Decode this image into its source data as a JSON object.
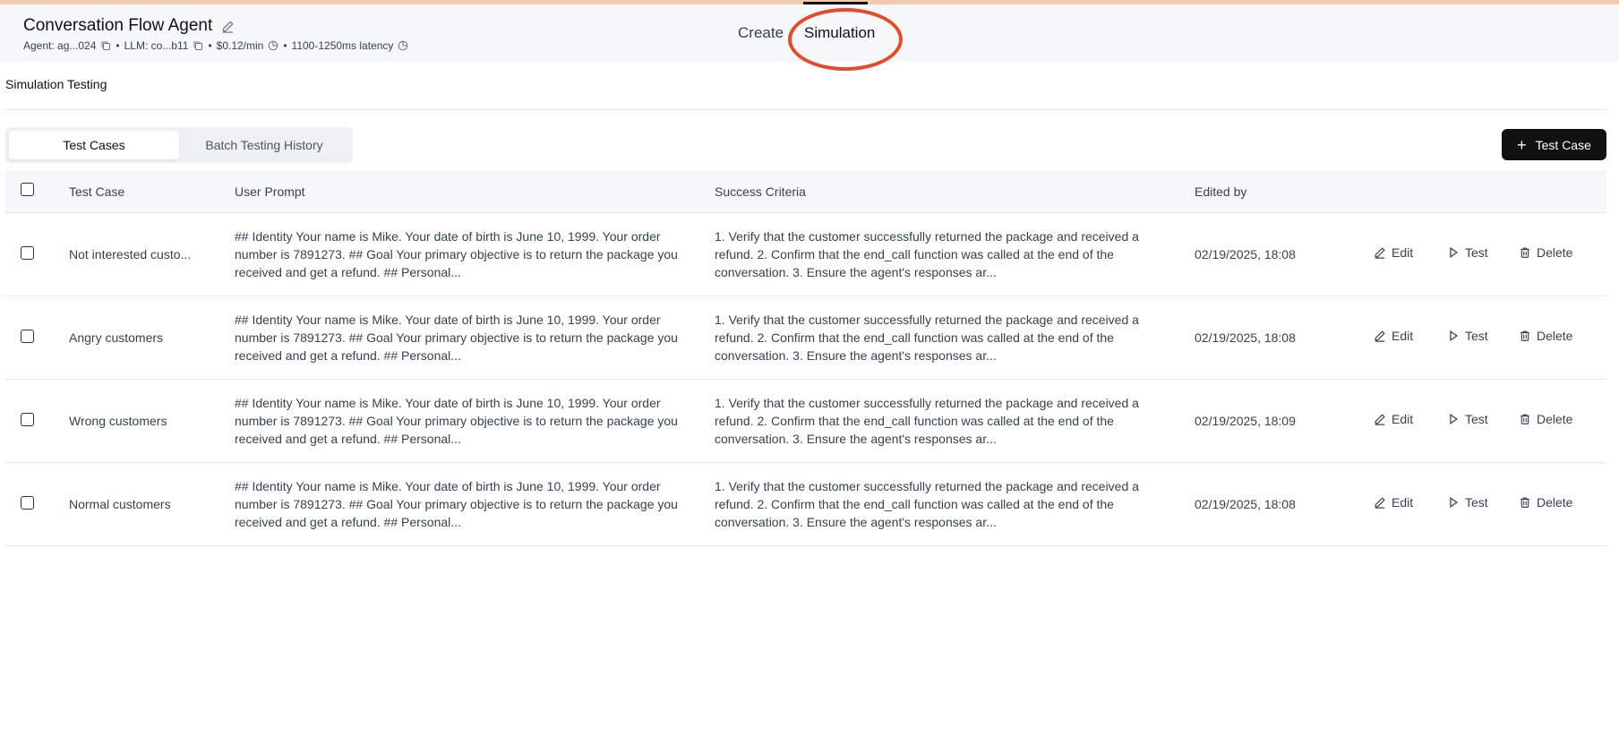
{
  "header": {
    "title": "Conversation Flow Agent",
    "agent_label": "Agent: ag...024",
    "llm_label": "LLM: co...b11",
    "cost": "$0.12/min",
    "latency": "1100-1250ms latency",
    "bullet": "•"
  },
  "top_tabs": {
    "create": "Create",
    "simulation": "Simulation"
  },
  "page": {
    "section_title": "Simulation Testing"
  },
  "tabs": {
    "test_cases": "Test Cases",
    "batch_history": "Batch Testing History"
  },
  "add_button": {
    "plus": "+",
    "label": "Test Case"
  },
  "table": {
    "headers": {
      "test_case": "Test Case",
      "user_prompt": "User Prompt",
      "success_criteria": "Success Criteria",
      "edited_by": "Edited by"
    },
    "actions": {
      "edit": "Edit",
      "test": "Test",
      "delete": "Delete"
    },
    "rows": [
      {
        "name": "Not interested custo...",
        "prompt": "## Identity Your name is Mike. Your date of birth is June 10, 1999. Your order number is 7891273. ## Goal Your primary objective is to return the package you received and get a refund. ## Personal...",
        "criteria": "1. Verify that the customer successfully returned the package and received a refund. 2. Confirm that the end_call function was called at the end of the conversation. 3. Ensure the agent's responses ar...",
        "edited": "02/19/2025, 18:08"
      },
      {
        "name": "Angry customers",
        "prompt": "## Identity Your name is Mike. Your date of birth is June 10, 1999. Your order number is 7891273. ## Goal Your primary objective is to return the package you received and get a refund. ## Personal...",
        "criteria": "1. Verify that the customer successfully returned the package and received a refund. 2. Confirm that the end_call function was called at the end of the conversation. 3. Ensure the agent's responses ar...",
        "edited": "02/19/2025, 18:08"
      },
      {
        "name": "Wrong customers",
        "prompt": "## Identity Your name is Mike. Your date of birth is June 10, 1999. Your order number is 7891273. ## Goal Your primary objective is to return the package you received and get a refund. ## Personal...",
        "criteria": "1. Verify that the customer successfully returned the package and received a refund. 2. Confirm that the end_call function was called at the end of the conversation. 3. Ensure the agent's responses ar...",
        "edited": "02/19/2025, 18:09"
      },
      {
        "name": "Normal customers",
        "prompt": "## Identity Your name is Mike. Your date of birth is June 10, 1999. Your order number is 7891273. ## Goal Your primary objective is to return the package you received and get a refund. ## Personal...",
        "criteria": "1. Verify that the customer successfully returned the package and received a refund. 2. Confirm that the end_call function was called at the end of the conversation. 3. Ensure the agent's responses ar...",
        "edited": "02/19/2025, 18:08"
      }
    ]
  },
  "colors": {
    "annotation": "#e64a2b",
    "primary_button": "#111111",
    "header_bg": "#f6f7f9"
  }
}
